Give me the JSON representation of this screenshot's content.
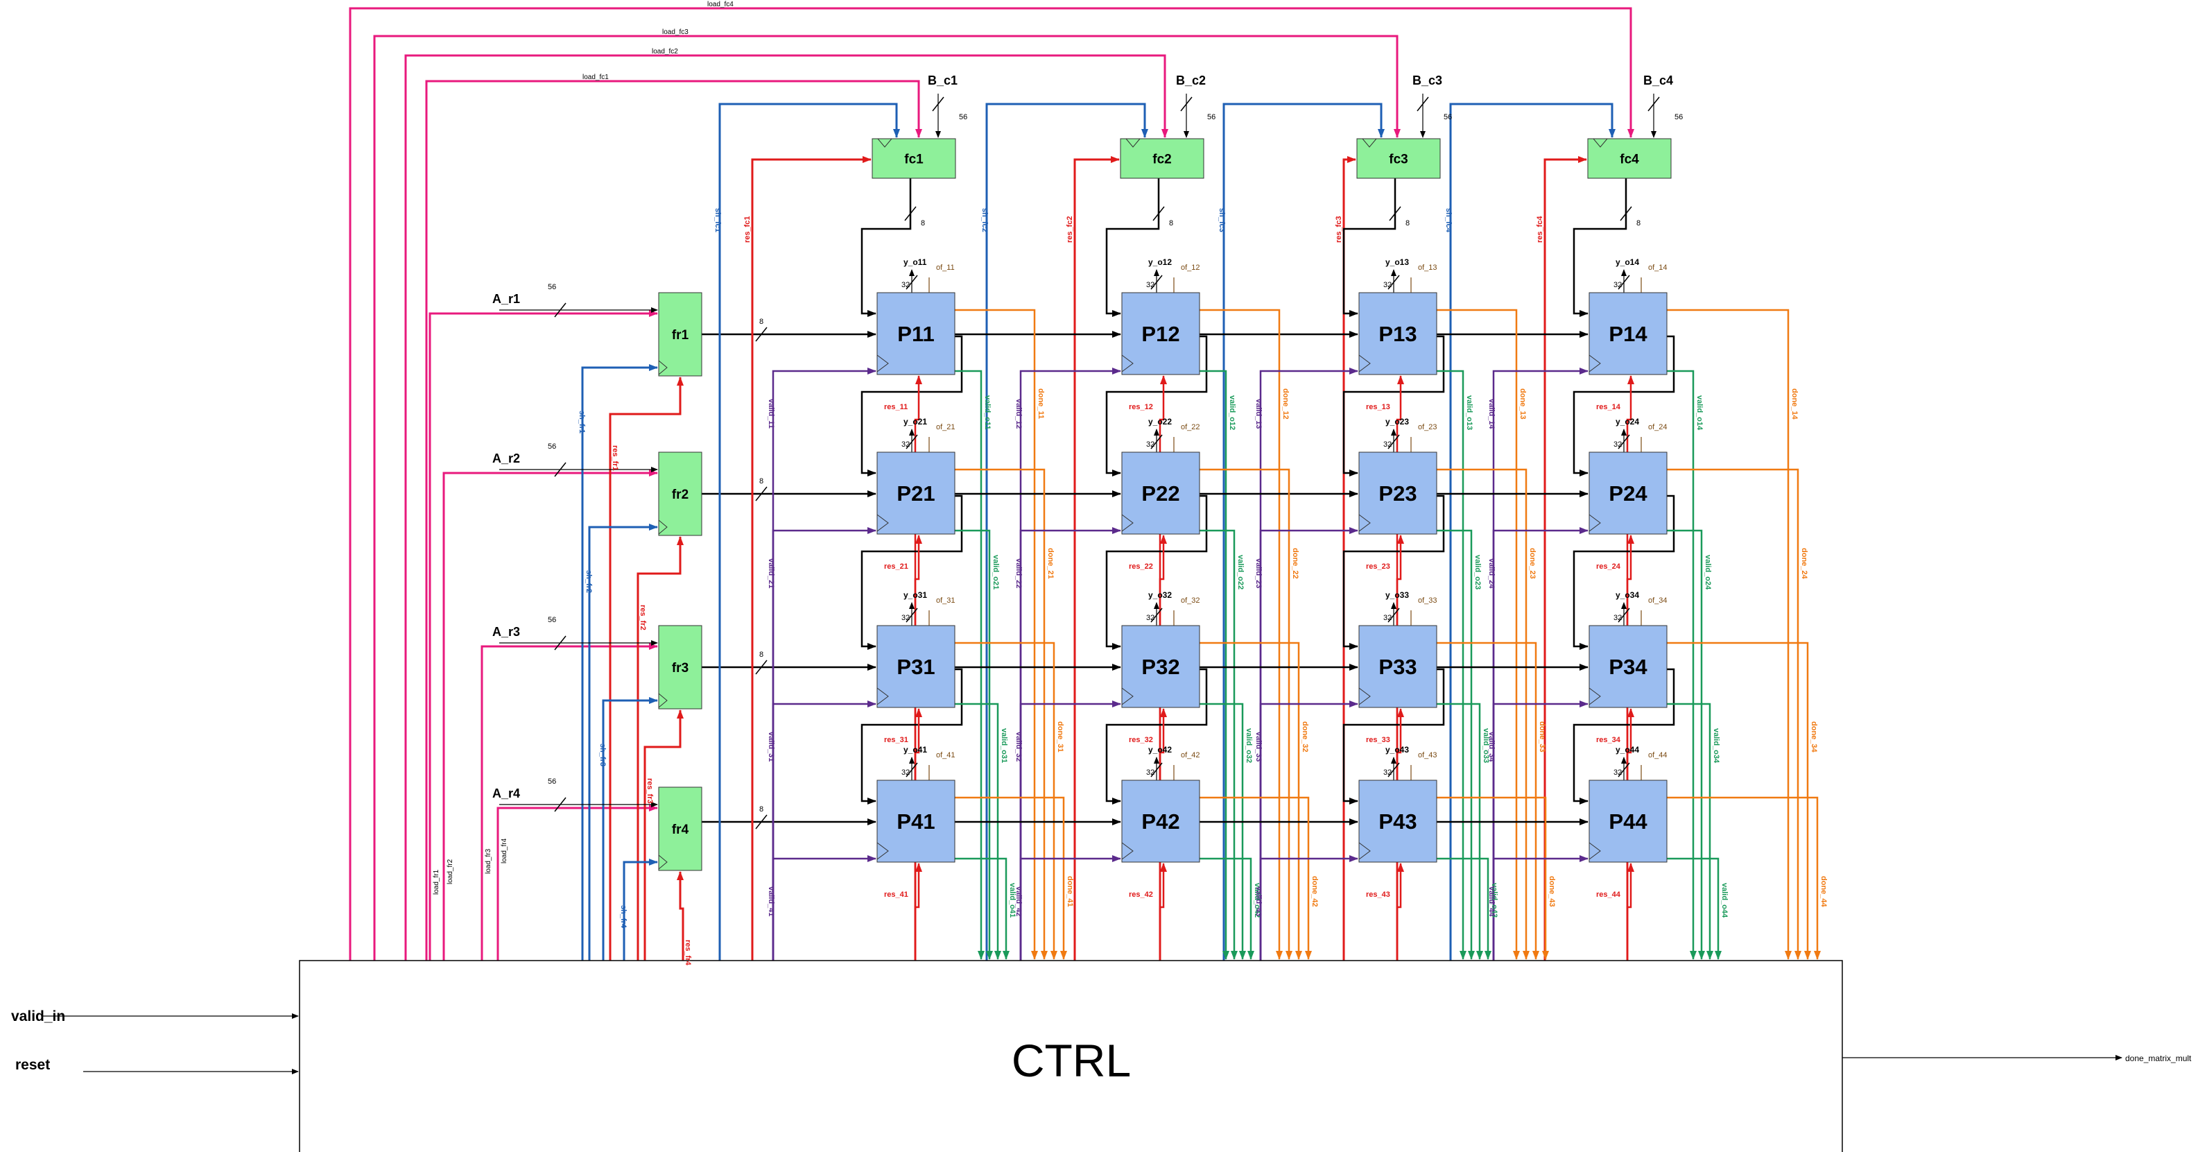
{
  "ctrl": {
    "label": "CTRL"
  },
  "inputs": {
    "valid_in": "valid_in",
    "reset": "reset"
  },
  "output": {
    "done": "done_matrix_mult"
  },
  "load_fc": [
    "load_fc1",
    "load_fc2",
    "load_fc3",
    "load_fc4"
  ],
  "load_fr": [
    "load_fr1",
    "load_fr2",
    "load_fr3",
    "load_fr4"
  ],
  "fc_blocks": [
    {
      "name": "fc1",
      "bus": "B_c1",
      "width": "56",
      "sh": "sh_fc1",
      "res": "res_fc1",
      "out": "8"
    },
    {
      "name": "fc2",
      "bus": "B_c2",
      "width": "56",
      "sh": "sh_fc2",
      "res": "res_fc2",
      "out": "8"
    },
    {
      "name": "fc3",
      "bus": "B_c3",
      "width": "56",
      "sh": "sh_fc3",
      "res": "res_fc3",
      "out": "8"
    },
    {
      "name": "fc4",
      "bus": "B_c4",
      "width": "56",
      "sh": "sh_fc4",
      "res": "res_fc4",
      "out": "8"
    }
  ],
  "fr_blocks": [
    {
      "name": "fr1",
      "bus": "A_r1",
      "width": "56",
      "sh": "sh_fr1",
      "res": "res_fr1",
      "out": "8"
    },
    {
      "name": "fr2",
      "bus": "A_r2",
      "width": "56",
      "sh": "sh_fr2",
      "res": "res_fr2",
      "out": "8"
    },
    {
      "name": "fr3",
      "bus": "A_r3",
      "width": "56",
      "sh": "sh_fr3",
      "res": "res_fr3",
      "out": "8"
    },
    {
      "name": "fr4",
      "bus": "A_r4",
      "width": "56",
      "sh": "sh_fr4",
      "res": "res_fr4",
      "out": "8"
    }
  ],
  "pe_width": "32",
  "pes": [
    {
      "name": "P11",
      "y": "y_o11",
      "of": "of_11",
      "res": "res_11",
      "valid": "valid_11",
      "valid_o": "valid_o11",
      "done": "done_11"
    },
    {
      "name": "P12",
      "y": "y_o12",
      "of": "of_12",
      "res": "res_12",
      "valid": "valid_12",
      "valid_o": "valid_o12",
      "done": "done_12"
    },
    {
      "name": "P13",
      "y": "y_o13",
      "of": "of_13",
      "res": "res_13",
      "valid": "valid_13",
      "valid_o": "valid_o13",
      "done": "done_13"
    },
    {
      "name": "P14",
      "y": "y_o14",
      "of": "of_14",
      "res": "res_14",
      "valid": "valid_14",
      "valid_o": "valid_o14",
      "done": "done_14"
    },
    {
      "name": "P21",
      "y": "y_o21",
      "of": "of_21",
      "res": "res_21",
      "valid": "valid_21",
      "valid_o": "valid_o21",
      "done": "done_21"
    },
    {
      "name": "P22",
      "y": "y_o22",
      "of": "of_22",
      "res": "res_22",
      "valid": "valid_22",
      "valid_o": "valid_o22",
      "done": "done_22"
    },
    {
      "name": "P23",
      "y": "y_o23",
      "of": "of_23",
      "res": "res_23",
      "valid": "valid_23",
      "valid_o": "valid_o23",
      "done": "done_23"
    },
    {
      "name": "P24",
      "y": "y_o24",
      "of": "of_24",
      "res": "res_24",
      "valid": "valid_24",
      "valid_o": "valid_o24",
      "done": "done_24"
    },
    {
      "name": "P31",
      "y": "y_o31",
      "of": "of_31",
      "res": "res_31",
      "valid": "valid_31",
      "valid_o": "valid_o31",
      "done": "done_31"
    },
    {
      "name": "P32",
      "y": "y_o32",
      "of": "of_32",
      "res": "res_32",
      "valid": "valid_32",
      "valid_o": "valid_o32",
      "done": "done_32"
    },
    {
      "name": "P33",
      "y": "y_o33",
      "of": "of_33",
      "res": "res_33",
      "valid": "valid_33",
      "valid_o": "valid_o33",
      "done": "done_33"
    },
    {
      "name": "P34",
      "y": "y_o34",
      "of": "of_34",
      "res": "res_34",
      "valid": "valid_34",
      "valid_o": "valid_o34",
      "done": "done_34"
    },
    {
      "name": "P41",
      "y": "y_o41",
      "of": "of_41",
      "res": "res_41",
      "valid": "valid_41",
      "valid_o": "valid_o41",
      "done": "done_41"
    },
    {
      "name": "P42",
      "y": "y_o42",
      "of": "of_42",
      "res": "res_42",
      "valid": "valid_42",
      "valid_o": "valid_o42",
      "done": "done_42"
    },
    {
      "name": "P43",
      "y": "y_o43",
      "of": "of_43",
      "res": "res_43",
      "valid": "valid_43",
      "valid_o": "valid_o43",
      "done": "done_43"
    },
    {
      "name": "P44",
      "y": "y_o44",
      "of": "of_44",
      "res": "res_44",
      "valid": "valid_44",
      "valid_o": "valid_o44",
      "done": "done_44"
    }
  ],
  "colors": {
    "fc_fill": "#8ef09a",
    "pe_fill": "#9bbdf0",
    "load": "#e8197d",
    "sh": "#1e5fb4",
    "res": "#e01a1a",
    "valid": "#5b2a8c",
    "valid_o": "#1a9a5a",
    "done": "#f07a12",
    "of": "#7a4a12"
  }
}
